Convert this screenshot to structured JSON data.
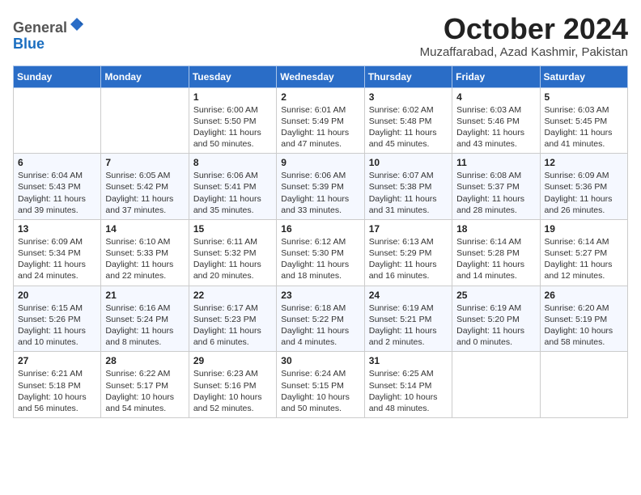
{
  "logo": {
    "general": "General",
    "blue": "Blue"
  },
  "title": "October 2024",
  "subtitle": "Muzaffarabad, Azad Kashmir, Pakistan",
  "headers": [
    "Sunday",
    "Monday",
    "Tuesday",
    "Wednesday",
    "Thursday",
    "Friday",
    "Saturday"
  ],
  "weeks": [
    [
      {
        "day": "",
        "info": ""
      },
      {
        "day": "",
        "info": ""
      },
      {
        "day": "1",
        "info": "Sunrise: 6:00 AM\nSunset: 5:50 PM\nDaylight: 11 hours and 50 minutes."
      },
      {
        "day": "2",
        "info": "Sunrise: 6:01 AM\nSunset: 5:49 PM\nDaylight: 11 hours and 47 minutes."
      },
      {
        "day": "3",
        "info": "Sunrise: 6:02 AM\nSunset: 5:48 PM\nDaylight: 11 hours and 45 minutes."
      },
      {
        "day": "4",
        "info": "Sunrise: 6:03 AM\nSunset: 5:46 PM\nDaylight: 11 hours and 43 minutes."
      },
      {
        "day": "5",
        "info": "Sunrise: 6:03 AM\nSunset: 5:45 PM\nDaylight: 11 hours and 41 minutes."
      }
    ],
    [
      {
        "day": "6",
        "info": "Sunrise: 6:04 AM\nSunset: 5:43 PM\nDaylight: 11 hours and 39 minutes."
      },
      {
        "day": "7",
        "info": "Sunrise: 6:05 AM\nSunset: 5:42 PM\nDaylight: 11 hours and 37 minutes."
      },
      {
        "day": "8",
        "info": "Sunrise: 6:06 AM\nSunset: 5:41 PM\nDaylight: 11 hours and 35 minutes."
      },
      {
        "day": "9",
        "info": "Sunrise: 6:06 AM\nSunset: 5:39 PM\nDaylight: 11 hours and 33 minutes."
      },
      {
        "day": "10",
        "info": "Sunrise: 6:07 AM\nSunset: 5:38 PM\nDaylight: 11 hours and 31 minutes."
      },
      {
        "day": "11",
        "info": "Sunrise: 6:08 AM\nSunset: 5:37 PM\nDaylight: 11 hours and 28 minutes."
      },
      {
        "day": "12",
        "info": "Sunrise: 6:09 AM\nSunset: 5:36 PM\nDaylight: 11 hours and 26 minutes."
      }
    ],
    [
      {
        "day": "13",
        "info": "Sunrise: 6:09 AM\nSunset: 5:34 PM\nDaylight: 11 hours and 24 minutes."
      },
      {
        "day": "14",
        "info": "Sunrise: 6:10 AM\nSunset: 5:33 PM\nDaylight: 11 hours and 22 minutes."
      },
      {
        "day": "15",
        "info": "Sunrise: 6:11 AM\nSunset: 5:32 PM\nDaylight: 11 hours and 20 minutes."
      },
      {
        "day": "16",
        "info": "Sunrise: 6:12 AM\nSunset: 5:30 PM\nDaylight: 11 hours and 18 minutes."
      },
      {
        "day": "17",
        "info": "Sunrise: 6:13 AM\nSunset: 5:29 PM\nDaylight: 11 hours and 16 minutes."
      },
      {
        "day": "18",
        "info": "Sunrise: 6:14 AM\nSunset: 5:28 PM\nDaylight: 11 hours and 14 minutes."
      },
      {
        "day": "19",
        "info": "Sunrise: 6:14 AM\nSunset: 5:27 PM\nDaylight: 11 hours and 12 minutes."
      }
    ],
    [
      {
        "day": "20",
        "info": "Sunrise: 6:15 AM\nSunset: 5:26 PM\nDaylight: 11 hours and 10 minutes."
      },
      {
        "day": "21",
        "info": "Sunrise: 6:16 AM\nSunset: 5:24 PM\nDaylight: 11 hours and 8 minutes."
      },
      {
        "day": "22",
        "info": "Sunrise: 6:17 AM\nSunset: 5:23 PM\nDaylight: 11 hours and 6 minutes."
      },
      {
        "day": "23",
        "info": "Sunrise: 6:18 AM\nSunset: 5:22 PM\nDaylight: 11 hours and 4 minutes."
      },
      {
        "day": "24",
        "info": "Sunrise: 6:19 AM\nSunset: 5:21 PM\nDaylight: 11 hours and 2 minutes."
      },
      {
        "day": "25",
        "info": "Sunrise: 6:19 AM\nSunset: 5:20 PM\nDaylight: 11 hours and 0 minutes."
      },
      {
        "day": "26",
        "info": "Sunrise: 6:20 AM\nSunset: 5:19 PM\nDaylight: 10 hours and 58 minutes."
      }
    ],
    [
      {
        "day": "27",
        "info": "Sunrise: 6:21 AM\nSunset: 5:18 PM\nDaylight: 10 hours and 56 minutes."
      },
      {
        "day": "28",
        "info": "Sunrise: 6:22 AM\nSunset: 5:17 PM\nDaylight: 10 hours and 54 minutes."
      },
      {
        "day": "29",
        "info": "Sunrise: 6:23 AM\nSunset: 5:16 PM\nDaylight: 10 hours and 52 minutes."
      },
      {
        "day": "30",
        "info": "Sunrise: 6:24 AM\nSunset: 5:15 PM\nDaylight: 10 hours and 50 minutes."
      },
      {
        "day": "31",
        "info": "Sunrise: 6:25 AM\nSunset: 5:14 PM\nDaylight: 10 hours and 48 minutes."
      },
      {
        "day": "",
        "info": ""
      },
      {
        "day": "",
        "info": ""
      }
    ]
  ]
}
